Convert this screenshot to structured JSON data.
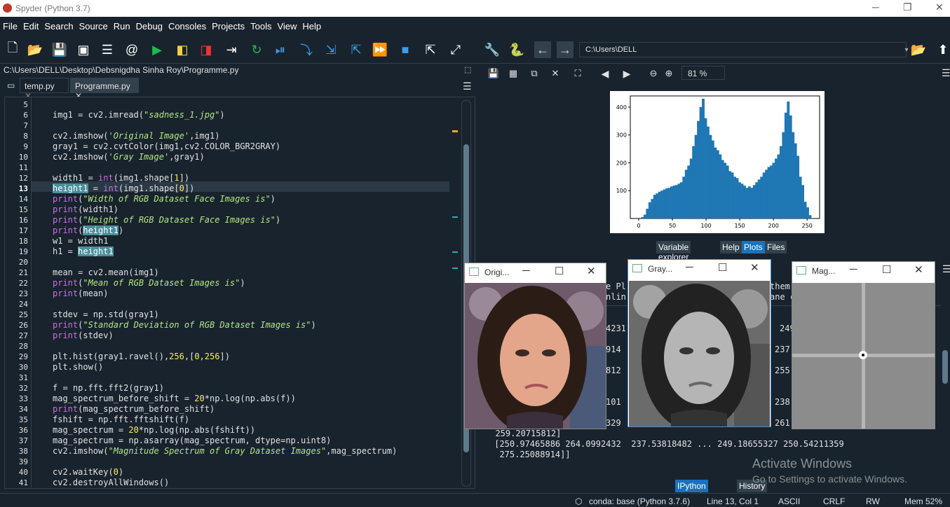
{
  "title": "Spyder (Python 3.7)",
  "menu": [
    "File",
    "Edit",
    "Search",
    "Source",
    "Run",
    "Debug",
    "Consoles",
    "Projects",
    "Tools",
    "View",
    "Help"
  ],
  "toolbar": {
    "path": "C:\\Users\\DELL"
  },
  "file_path": "C:\\Users\\DELL\\Desktop\\Debsnigdha Sinha Roy\\Programme.py",
  "tabs": [
    "temp.py",
    "Programme.py"
  ],
  "lines": [
    "5",
    "6",
    "7",
    "8",
    "9",
    "10",
    "11",
    "12",
    "13",
    "14",
    "15",
    "16",
    "17",
    "18",
    "19",
    "20",
    "21",
    "22",
    "23",
    "24",
    "25",
    "26",
    "27",
    "28",
    "29",
    "30",
    "31",
    "32",
    "33",
    "34",
    "35",
    "36",
    "37",
    "38",
    "39",
    "40",
    "41"
  ],
  "plots": {
    "zoom": "81 %"
  },
  "chart_data": {
    "type": "bar",
    "title": "",
    "xlabel": "",
    "ylabel": "",
    "xlim": [
      0,
      256
    ],
    "ylim": [
      0,
      440
    ],
    "x_ticks": [
      "0",
      "50",
      "100",
      "150",
      "200",
      "250"
    ],
    "y_ticks": [
      "100",
      "200",
      "300",
      "400"
    ],
    "values": [
      2,
      5,
      14,
      35,
      58,
      70,
      85,
      90,
      96,
      100,
      104,
      108,
      110,
      115,
      118,
      120,
      125,
      130,
      150,
      175,
      190,
      215,
      260,
      300,
      350,
      400,
      430,
      360,
      330,
      300,
      280,
      255,
      245,
      230,
      210,
      200,
      190,
      170,
      165,
      150,
      145,
      130,
      125,
      118,
      110,
      115,
      110,
      120,
      130,
      140,
      150,
      165,
      175,
      185,
      190,
      200,
      215,
      230,
      260,
      310,
      380,
      420,
      370,
      310,
      270,
      225,
      150,
      120,
      60,
      40,
      12
    ]
  },
  "pane_tabs": [
    "Variable explorer",
    "Help",
    "Plots",
    "Files"
  ],
  "windows": {
    "orig": "Origi...",
    "gray": "Gray...",
    "mag": "Mag..."
  },
  "console": {
    "frag": [
      "e Pl",
      "nlin",
      "4231",
      "914",
      "812",
      "101",
      "329"
    ],
    "right_frag": [
      "them",
      "ane c",
      "249",
      "237.",
      "255.",
      "238.",
      "261."
    ],
    "l1": "  259.20715812]",
    "l2": " [250.97465886 264.0992432  237.53818482 ... 249.18655327 250.54211359",
    "l3": "  275.25088914]]"
  },
  "console_tabs": [
    "IPython console",
    "History"
  ],
  "watermark": {
    "title": "Activate Windows",
    "sub": "Go to Settings to activate Windows."
  },
  "status": {
    "env": "conda: base (Python 3.7.6)",
    "pos": "Line 13, Col 1",
    "enc": "ASCII",
    "eol": "CRLF",
    "rw": "RW",
    "mem": "Mem 52%"
  }
}
